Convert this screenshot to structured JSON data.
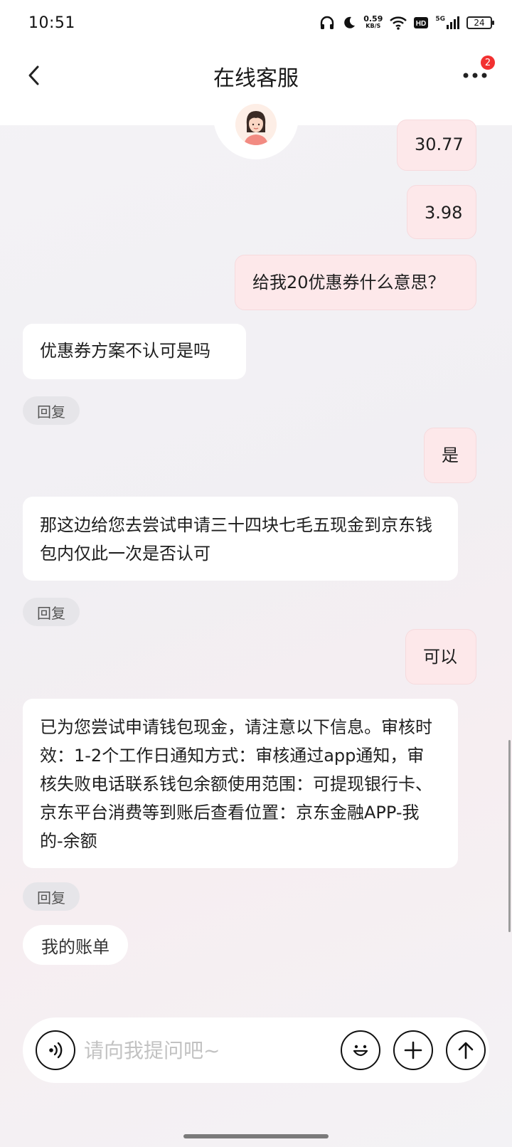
{
  "status_bar": {
    "time": "10:51",
    "net_speed_value": "0.59",
    "net_speed_unit": "KB/S",
    "network": "5G",
    "battery": "24"
  },
  "header": {
    "title": "在线客服",
    "more_badge": "2"
  },
  "messages": [
    {
      "side": "user",
      "text": "30.77"
    },
    {
      "side": "user",
      "text": "3.98"
    },
    {
      "side": "user",
      "text": "给我20优惠券什么意思？"
    },
    {
      "side": "agent",
      "text": "优惠券方案不认可是吗"
    },
    {
      "side": "user",
      "text": "是"
    },
    {
      "side": "agent",
      "text": "那这边给您去尝试申请三十四块七毛五现金到京东钱包内仅此一次是否认可"
    },
    {
      "side": "user",
      "text": "可以"
    },
    {
      "side": "agent",
      "text": "已为您尝试申请钱包现金，请注意以下信息。审核时效：1-2个工作日通知方式：审核通过app通知，审核失败电话联系钱包余额使用范围：可提现银行卡、京东平台消费等到账后查看位置：京东金融APP-我的-余额"
    }
  ],
  "reply_label": "回复",
  "quick_reply": "我的账单",
  "input": {
    "placeholder": "请向我提问吧~",
    "value": ""
  },
  "icons": {
    "back": "chevron-left-icon",
    "more": "more-dots-icon",
    "voice": "voice-icon",
    "emoji": "emoji-icon",
    "plus": "plus-icon",
    "send": "send-arrow-icon"
  },
  "colors": {
    "user_bubble": "#fde8ea",
    "agent_bubble": "#ffffff",
    "badge": "#f23030"
  }
}
